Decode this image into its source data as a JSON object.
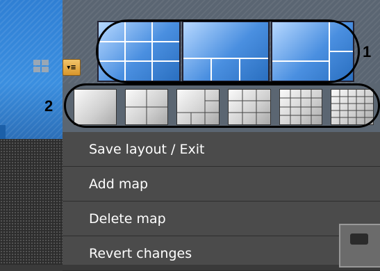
{
  "annotations": {
    "label1": "1",
    "label2": "2"
  },
  "menu": {
    "items": [
      {
        "label": "Save layout / Exit"
      },
      {
        "label": "Add map"
      },
      {
        "label": "Delete map"
      },
      {
        "label": "Revert changes"
      }
    ]
  },
  "colors": {
    "menu_bg": "#4b4b4b",
    "menu_button": "#d8962b",
    "layout_thumb_blue": "#4a8fe0",
    "annotation_outline": "#000000"
  },
  "icons": {
    "menu_button": "menu-icon",
    "left_grid": "grid-icon"
  }
}
